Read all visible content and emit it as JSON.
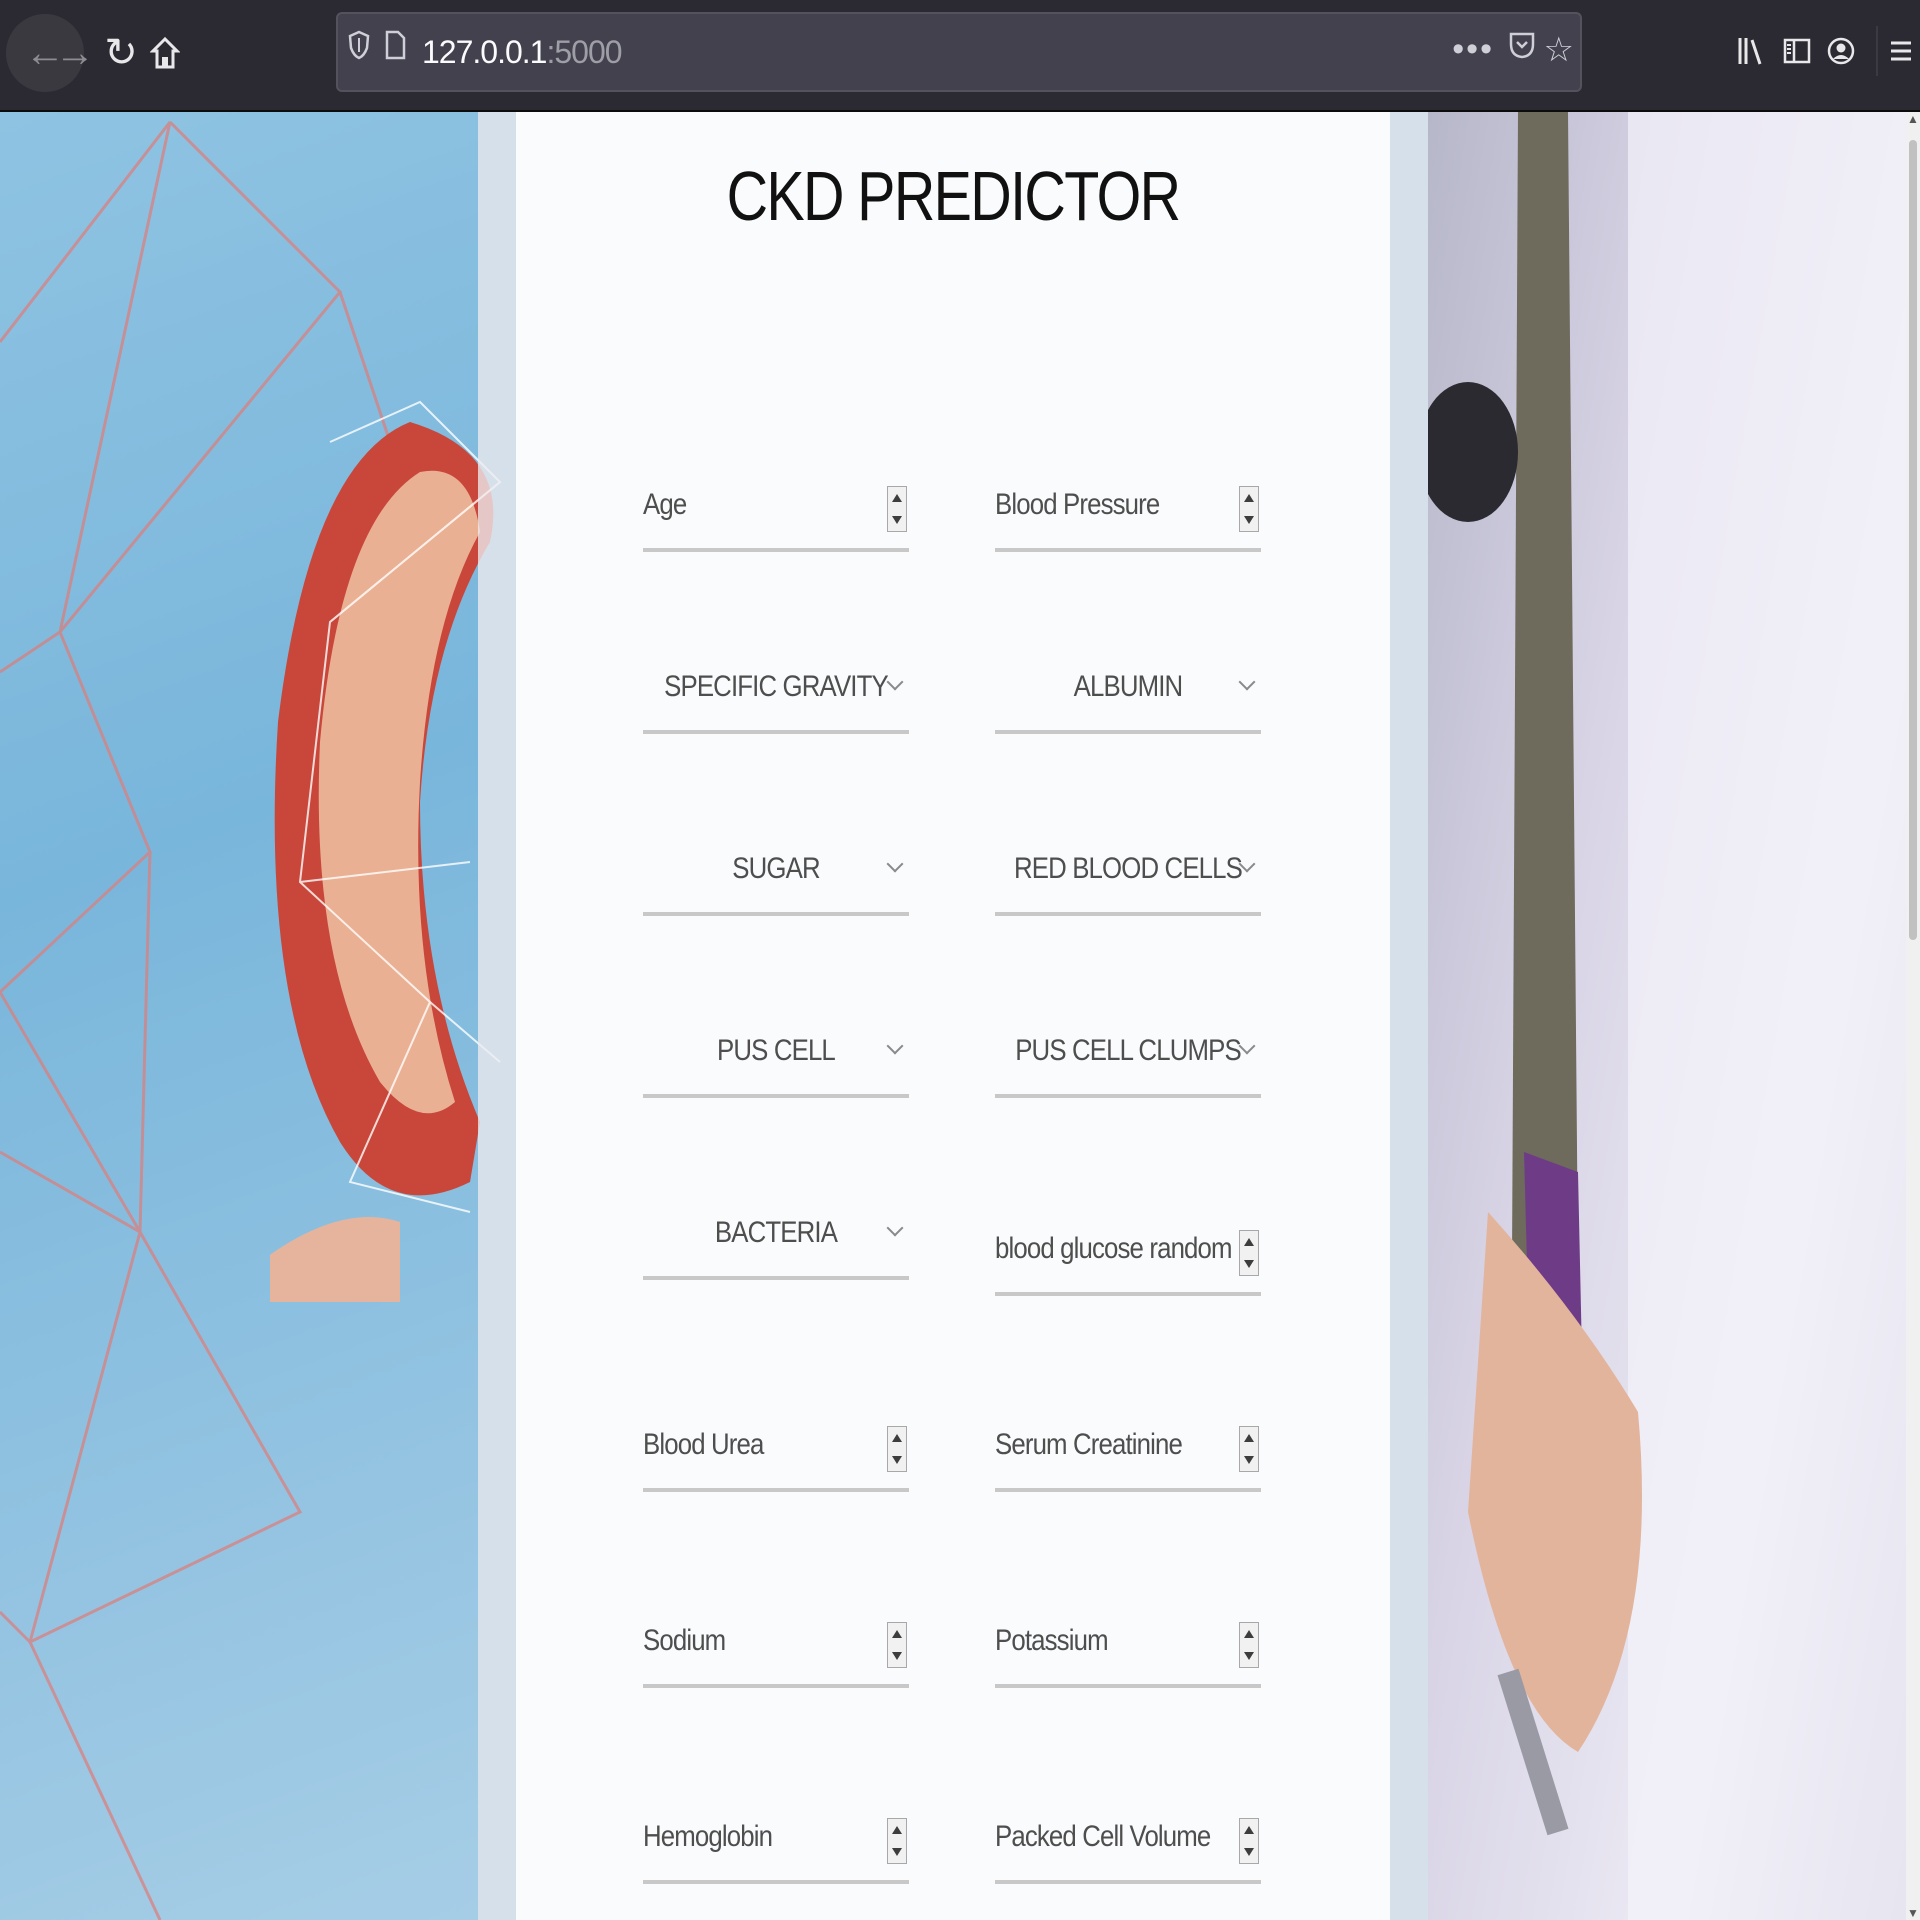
{
  "browser": {
    "url_host": "127.0.0.1",
    "url_port": ":5000"
  },
  "page": {
    "title": "CKD PREDICTOR"
  },
  "form": {
    "age": "Age",
    "blood_pressure": "Blood Pressure",
    "specific_gravity": "SPECIFIC GRAVITY",
    "albumin": "ALBUMIN",
    "sugar": "SUGAR",
    "red_blood_cells": "RED BLOOD CELLS",
    "pus_cell": "PUS CELL",
    "pus_cell_clumps": "PUS CELL CLUMPS",
    "bacteria": "BACTERIA",
    "blood_glucose_random": "blood glucose random",
    "blood_urea": "Blood Urea",
    "serum_creatinine": "Serum Creatinine",
    "sodium": "Sodium",
    "potassium": "Potassium",
    "hemoglobin": "Hemoglobin",
    "packed_cell_volume": "Packed Cell Volume"
  },
  "icons": {
    "back": "arrow-left-icon",
    "forward": "arrow-right-icon",
    "reload": "reload-icon",
    "home": "home-icon",
    "shield": "tracking-shield-icon",
    "page": "page-icon",
    "more": "page-actions-icon",
    "pocket": "pocket-icon",
    "star": "bookmark-star-icon",
    "library": "library-icon",
    "sidebar": "sidebar-icon",
    "account": "account-icon",
    "menu": "hamburger-menu-icon"
  },
  "colors": {
    "chrome_bg": "#2b2a33",
    "urlbar_bg": "#42414d",
    "field_underline": "#c8c8c8",
    "title_text": "#111111"
  }
}
